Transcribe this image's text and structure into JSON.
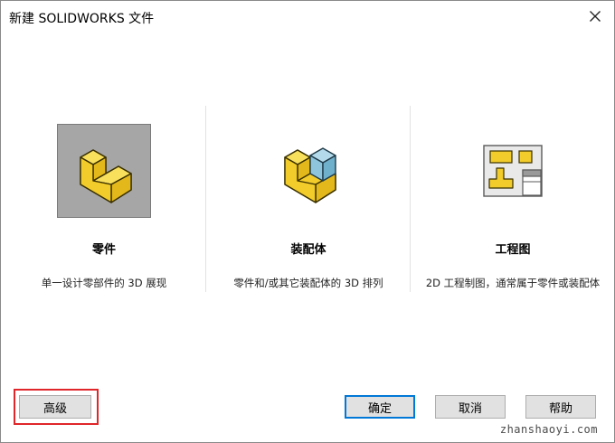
{
  "window": {
    "title": "新建 SOLIDWORKS 文件"
  },
  "templates": [
    {
      "name": "零件",
      "description": "单一设计零部件的 3D 展现",
      "icon": "part-icon",
      "selected": true
    },
    {
      "name": "装配体",
      "description": "零件和/或其它装配体的 3D 排列",
      "icon": "assembly-icon",
      "selected": false
    },
    {
      "name": "工程图",
      "description": "2D 工程制图，通常属于零件或装配体",
      "icon": "drawing-icon",
      "selected": false
    }
  ],
  "buttons": {
    "advanced": "高级",
    "ok": "确定",
    "cancel": "取消",
    "help": "帮助"
  },
  "watermark": "zhanshaoyi.com",
  "colors": {
    "part_yellow": "#f2cc2a",
    "assembly_blue": "#8ec5dd",
    "highlight_red": "#e0262a",
    "default_button_border": "#0078d7",
    "selected_bg": "#a6a6a6"
  }
}
